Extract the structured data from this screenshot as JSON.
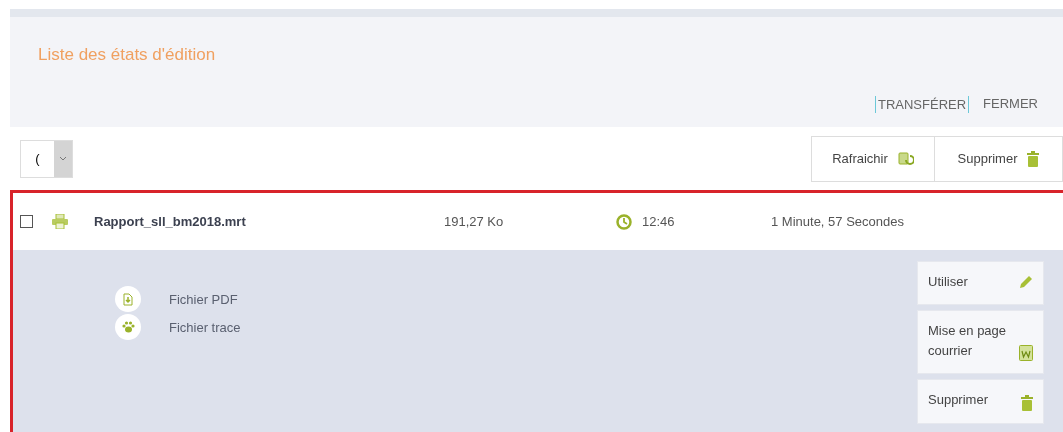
{
  "title": "Liste des états d'édition",
  "header_links": [
    {
      "label": "TRANSFÉRER",
      "selected": true
    },
    {
      "label": "FERMER",
      "selected": false
    }
  ],
  "toolbar": {
    "select_value": "(",
    "buttons": [
      {
        "label": "Rafraichir",
        "kind": "refresh"
      },
      {
        "label": "Supprimer",
        "kind": "delete"
      }
    ]
  },
  "rows": [
    {
      "checked": false,
      "selected": true,
      "name": "Rapport_sll_bm2018.mrt",
      "size": "191,27 Ko",
      "time": "12:46",
      "duration": "1 Minute, 57 Secondes",
      "files": [
        {
          "label": "Fichier PDF",
          "kind": "pdf"
        },
        {
          "label": "Fichier trace",
          "kind": "trace"
        }
      ],
      "actions": [
        {
          "label": "Utiliser",
          "kind": "edit"
        },
        {
          "label": "Mise en page courrier",
          "kind": "word"
        },
        {
          "label": "Supprimer",
          "kind": "delete"
        }
      ]
    }
  ]
}
